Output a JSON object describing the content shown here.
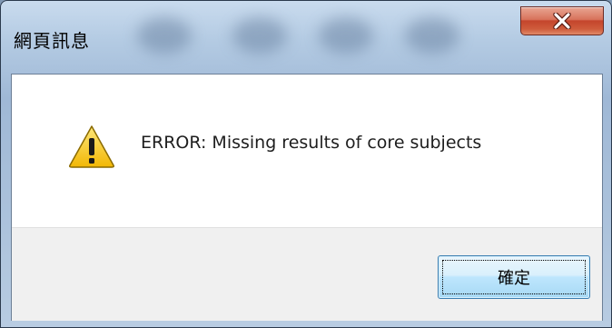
{
  "window": {
    "title": "網頁訊息"
  },
  "titlebar": {
    "close_icon": "close-icon"
  },
  "dialog": {
    "icon": "warning-icon",
    "message": "ERROR: Missing results of core subjects",
    "ok_label": "確定"
  },
  "colors": {
    "close_button": "#c4452c",
    "ok_button_border": "#3c7fb1",
    "warning_fill": "#f7c81e",
    "button_area": "#f0f0f0"
  }
}
